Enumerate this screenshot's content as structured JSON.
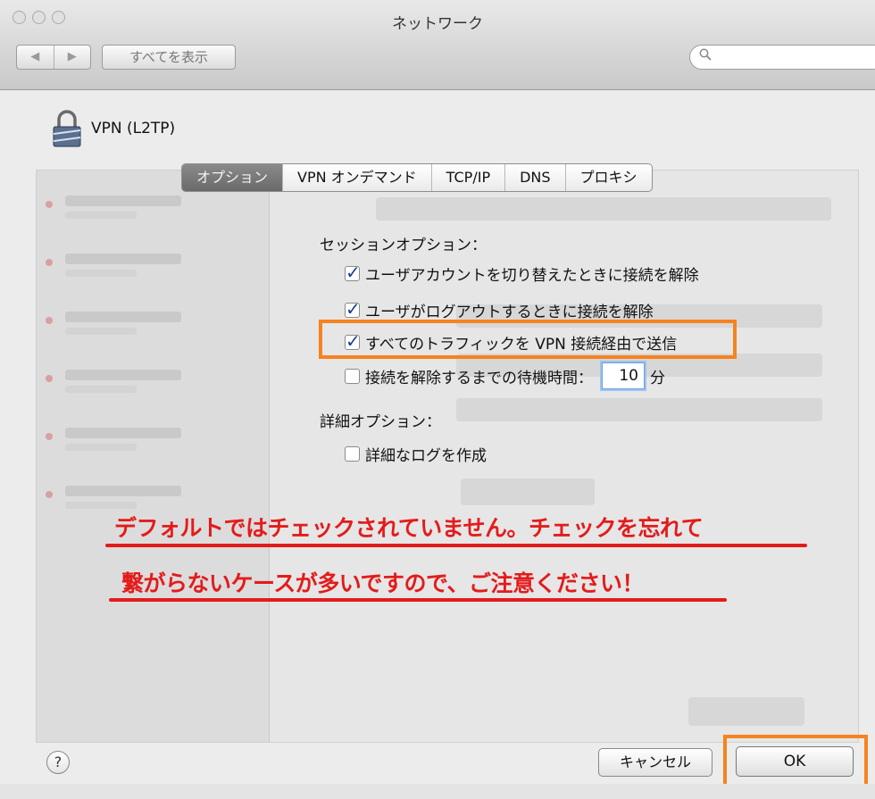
{
  "window": {
    "title": "ネットワーク"
  },
  "toolbar": {
    "back": "◀",
    "forward": "▶",
    "show_all": "すべてを表示",
    "search_icon": "search-icon",
    "search_placeholder": ""
  },
  "service": {
    "name": "VPN (L2TP)",
    "icon": "lock-icon"
  },
  "tabs": [
    {
      "label": "オプション",
      "active": true
    },
    {
      "label": "VPN オンデマンド",
      "active": false
    },
    {
      "label": "TCP/IP",
      "active": false
    },
    {
      "label": "DNS",
      "active": false
    },
    {
      "label": "プロキシ",
      "active": false
    }
  ],
  "session": {
    "heading": "セッションオプション：",
    "options": [
      {
        "label": "ユーザアカウントを切り替えたときに接続を解除",
        "checked": true
      },
      {
        "label": "ユーザがログアウトするときに接続を解除",
        "checked": true
      },
      {
        "label": "すべてのトラフィックを VPN 接続経由で送信",
        "checked": true
      },
      {
        "label": "接続を解除するまでの待機時間：",
        "checked": false
      }
    ],
    "wait_value": "10",
    "wait_unit": "分"
  },
  "advanced": {
    "heading": "詳細オプション：",
    "options": [
      {
        "label": "詳細なログを作成",
        "checked": false
      }
    ]
  },
  "annotation": {
    "line1": "デフォルトではチェックされていません。チェックを忘れて",
    "line2": "繋がらないケースが多いですので、ご注意ください！",
    "color": "#e41b1b",
    "highlight_color": "#f5831f"
  },
  "footer": {
    "help": "?",
    "cancel": "キャンセル",
    "ok": "OK"
  }
}
